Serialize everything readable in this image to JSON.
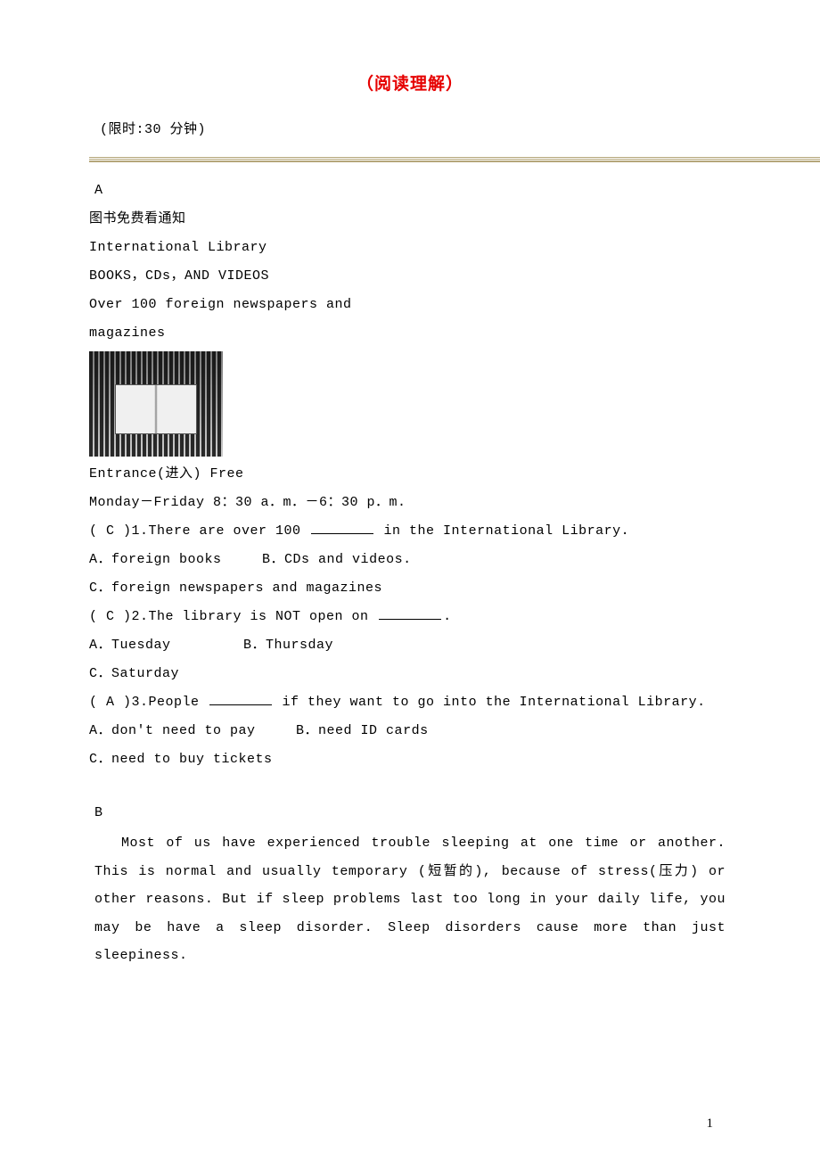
{
  "title": "（阅读理解）",
  "timer": "(限时:30 分钟)",
  "sectionA": {
    "label": "A",
    "subtitle": "图书免费看通知",
    "lines": [
      "International Library",
      "BOOKS，CDs，AND VIDEOS",
      "Over 100 foreign newspapers and",
      "magazines"
    ],
    "afterImage": [
      "Entrance(进入) Free",
      "Monday－Friday 8：30 a．m．－6：30 p．m."
    ],
    "q1": {
      "stem_pre": "( C )1.There are over 100 ",
      "stem_post": " in the International Library.",
      "optA": "A．foreign books",
      "optB": "B．CDs and videos.",
      "optC": "C．foreign newspapers and magazines"
    },
    "q2": {
      "stem_pre": "( C )2.The library is NOT open on ",
      "stem_post": ".",
      "optA": "A．Tuesday",
      "optB": "B．Thursday",
      "optC": "C．Saturday"
    },
    "q3": {
      "stem_pre": "( A )3.People ",
      "stem_post": " if they want to go into the International Library.",
      "optA": "A．don't need to pay",
      "optB": "B．need ID cards",
      "optC": "C．need to buy tickets"
    }
  },
  "sectionB": {
    "label": "B",
    "paragraph": "Most of us have experienced trouble sleeping at one time or another. This is normal and usually temporary (短暂的), because of stress(压力) or other reasons. But if sleep problems last too long in your daily life, you may be have a sleep disorder. Sleep disorders cause more than just sleepiness."
  },
  "pageNumber": "1"
}
